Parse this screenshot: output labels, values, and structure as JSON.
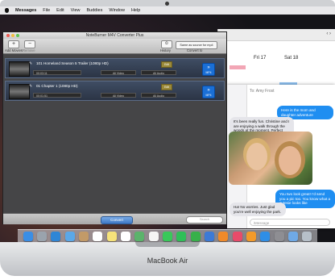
{
  "device": {
    "label": "MacBook Air"
  },
  "menubar": {
    "app_name": "Messages",
    "items": [
      "File",
      "Edit",
      "View",
      "Buddies",
      "Window",
      "Help"
    ]
  },
  "calendar": {
    "nav": "‹  ›",
    "days": [
      "Fri 17",
      "Sat 18"
    ]
  },
  "converter": {
    "title": "NoteBurner M4V Converter Plus",
    "toolbar": {
      "add_label": "Add Movies",
      "remove_label": "Remove",
      "history_label": "History",
      "same_source_label": "Same as source for mp4",
      "convert_to_label": "Convert to"
    },
    "rows": [
      {
        "title": "101 Homeland Season 5 Trailer (1080p HD)",
        "duration": "00:03:11",
        "video": "All Video",
        "audio": "All Audio",
        "edit": "Edit",
        "format": "MP4"
      },
      {
        "title": "01 Chapter 1 (1080p HD)",
        "duration": "00:01:51",
        "video": "All Video",
        "audio": "All Audio",
        "edit": "Edit",
        "format": "MP4"
      }
    ],
    "convert_button": "Convert",
    "search_placeholder": "Search"
  },
  "messages": {
    "to_label": "To:  Amy Frost",
    "bubbles": [
      {
        "text": "Here is the mom and daughter adventure",
        "dir": "out"
      },
      {
        "text": "It's been really fun. Christine and I are enjoying a walk through the woods at the moment. Perfect opportunity for a photo.",
        "dir": "in"
      },
      {
        "text": "You two look great! I'd send you a pic too. You know what a cutesie looks like",
        "dir": "out"
      },
      {
        "text": "Ha! No worries. Just glad you're well enjoying the park.",
        "dir": "in"
      }
    ],
    "input_placeholder": "iMessage"
  },
  "dock": {
    "icons": [
      "finder-icon",
      "launchpad-icon",
      "safari-icon",
      "mail-icon",
      "contacts-icon",
      "calendar-icon",
      "notes-icon",
      "reminders-icon",
      "maps-icon",
      "photos-icon",
      "messages-icon",
      "facetime-icon",
      "numbers-icon",
      "keynote-icon",
      "pages-icon",
      "itunes-icon",
      "ibooks-icon",
      "appstore-icon",
      "preferences-icon",
      "downloads-icon",
      "trash-icon"
    ],
    "colors": [
      "#3a8ee6",
      "#9aa3ad",
      "#2f86d6",
      "#5ba8e8",
      "#c29a68",
      "#ffffff",
      "#f6e27a",
      "#ffffff",
      "#5bb36b",
      "#f5f5f5",
      "#39c85a",
      "#2fbf58",
      "#37b04a",
      "#3c7ad6",
      "#f08a2a",
      "#e84b6a",
      "#f39a2a",
      "#2f8ee6",
      "#8e8e93",
      "#6fa9e6",
      "#b7c0c9"
    ]
  }
}
